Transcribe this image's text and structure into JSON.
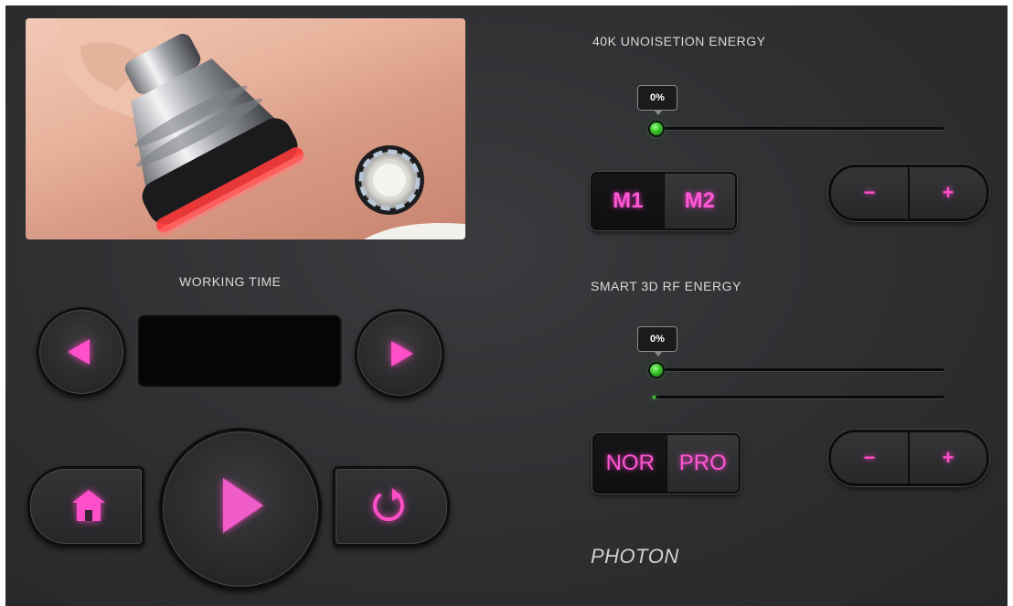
{
  "ultrasonic": {
    "title": "40K UNOISETION ENERGY",
    "value": 0,
    "value_label": "0%",
    "modes": [
      "M1",
      "M2"
    ],
    "active_mode": "M1",
    "minus_label": "−",
    "plus_label": "+"
  },
  "rf": {
    "title": "SMART 3D RF ENERGY",
    "value": 0,
    "value_label": "0%",
    "secondary_value": 0,
    "modes": [
      "NOR",
      "PRO"
    ],
    "active_mode": "NOR",
    "minus_label": "−",
    "plus_label": "+"
  },
  "working_time": {
    "title": "WORKING TIME",
    "display_value": ""
  },
  "photon": {
    "label": "PHOTON"
  },
  "icons": {
    "prev": "triangle-left-icon",
    "next": "triangle-right-icon",
    "home": "home-icon",
    "play": "play-icon",
    "reset": "refresh-icon"
  },
  "colors": {
    "accent": "#ff4fc8",
    "knob": "#35c126",
    "panel": "#2e2f31"
  }
}
